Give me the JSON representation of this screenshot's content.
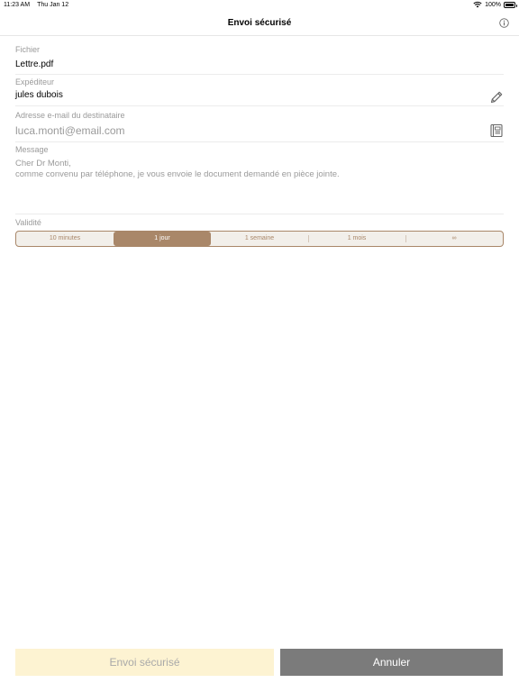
{
  "status": {
    "time": "11:23 AM",
    "date": "Thu Jan 12",
    "battery": "100%"
  },
  "nav": {
    "title": "Envoi sécurisé"
  },
  "form": {
    "file": {
      "label": "Fichier",
      "value": "Lettre.pdf"
    },
    "sender": {
      "label": "Expéditeur",
      "value": "jules dubois"
    },
    "recipient": {
      "label": "Adresse e-mail du destinataire",
      "placeholder": "luca.monti@email.com"
    },
    "message": {
      "label": "Message",
      "placeholder": "Cher Dr Monti,\ncomme convenu par téléphone, je vous envoie le document demandé en pièce jointe."
    },
    "validity": {
      "label": "Validité",
      "options": [
        "10 minutes",
        "1 jour",
        "1 semaine",
        "1 mois",
        "∞"
      ],
      "selected": "1 jour"
    }
  },
  "actions": {
    "send_label": "Envoi sécurisé",
    "cancel_label": "Annuler"
  },
  "colors": {
    "accent": "#a98769",
    "send_bg": "#fdf3d2",
    "cancel_bg": "#7b7b7b"
  },
  "icons": {
    "info": "info-circle-icon",
    "sender_edit": "pencil-icon",
    "contacts": "address-book-icon"
  }
}
